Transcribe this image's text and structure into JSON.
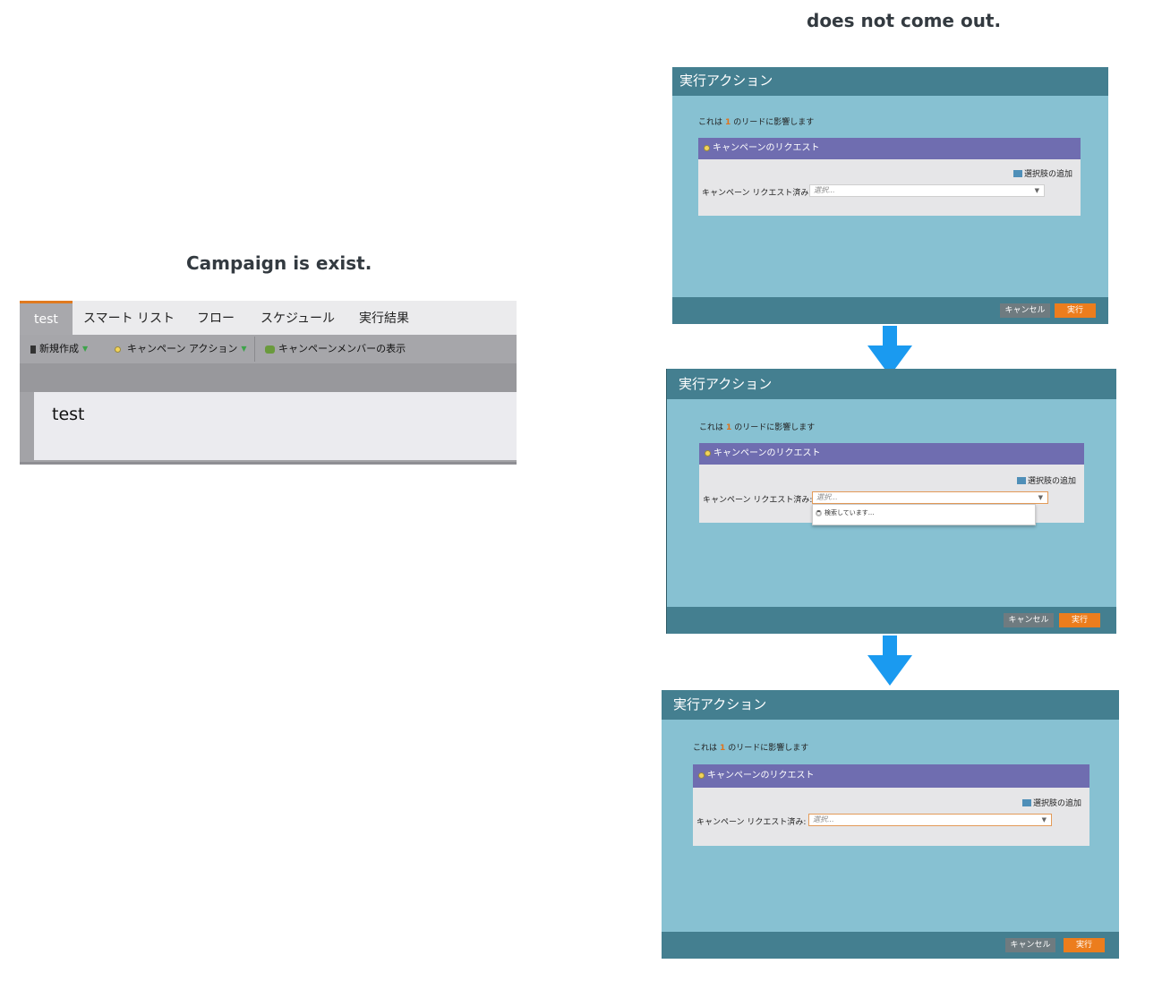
{
  "captions": {
    "left": "Campaign is exist.",
    "right": "does not come out."
  },
  "program": {
    "tabs": [
      "test",
      "スマート リスト",
      "フロー",
      "スケジュール",
      "実行結果"
    ],
    "toolbar": {
      "new": "新規作成",
      "campaign_action": "キャンペーン アクション",
      "show_members": "キャンペーンメンバーの表示"
    },
    "content_title": "test"
  },
  "dialog": {
    "title": "実行アクション",
    "affect_prefix": "これは",
    "affect_count": "1",
    "affect_suffix": "のリードに影響します",
    "section_title": "キャンペーンのリクエスト",
    "add_option": "選択肢の追加",
    "field_label": "キャンペーン リクエスト済み:",
    "placeholder": "選択...",
    "searching": "検索しています...",
    "cancel": "キャンセル",
    "run": "実行"
  },
  "colors": {
    "dialog_header": "#447f90",
    "dialog_body": "#87c1d2",
    "section_header": "#6f6db0",
    "run_button": "#ec7d1d",
    "arrow": "#1a9af0"
  },
  "icons": [
    "arrow-down-icon",
    "bulb-icon",
    "add-option-icon",
    "spinner-icon",
    "dropdown-caret-icon"
  ]
}
